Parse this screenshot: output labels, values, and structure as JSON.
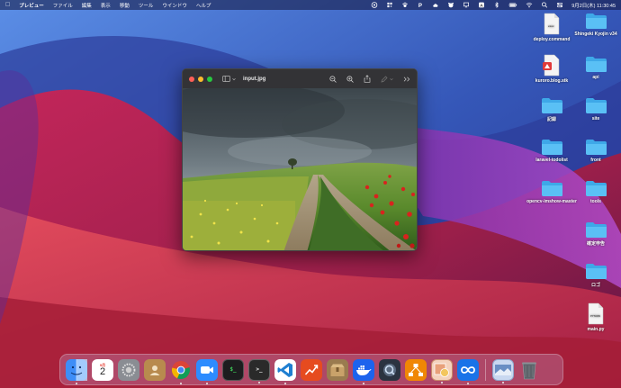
{
  "menubar": {
    "apple_icon": "apple-icon",
    "app_name": "プレビュー",
    "menus": [
      "ファイル",
      "編集",
      "表示",
      "移動",
      "ツール",
      "ウインドウ",
      "ヘルプ"
    ],
    "status_icons": [
      "obs-icon",
      "qr-icon",
      "paw-icon",
      "patreon-icon",
      "cloud-icon",
      "bear-icon",
      "cast-icon",
      "input-method-icon",
      "bluetooth-icon",
      "battery-icon",
      "wifi-icon",
      "search-icon",
      "control-center-icon"
    ],
    "input_method": "A",
    "clock": "9月2日(木)  11:30:45"
  },
  "desktop": {
    "items": [
      {
        "label": "deploy.command",
        "type": "document",
        "doc_label": "exec"
      },
      {
        "label": "Shingeki Kyojin v34",
        "type": "folder"
      },
      {
        "label": "kuroro.blog.stk",
        "type": "document",
        "doc_label": ""
      },
      {
        "label": "api",
        "type": "folder"
      },
      {
        "label": "記録",
        "type": "folder"
      },
      {
        "label": "site",
        "type": "folder"
      },
      {
        "label": "laravel-todolist",
        "type": "folder"
      },
      {
        "label": "front",
        "type": "folder"
      },
      {
        "label": "opencv-imshow-master",
        "type": "folder"
      },
      {
        "label": "tools",
        "type": "folder"
      },
      {
        "label": "確定申告",
        "type": "folder"
      },
      {
        "label": "ロゴ",
        "type": "folder"
      },
      {
        "label": "main.py",
        "type": "document",
        "doc_label": "PYTHON"
      }
    ]
  },
  "window": {
    "title": "input.jpg",
    "toolbar_icons": [
      "sidebar-toggle-icon",
      "zoom-out-icon",
      "zoom-in-icon",
      "share-icon",
      "markup-icon",
      "more-icon"
    ]
  },
  "dock": {
    "apps": [
      {
        "name": "finder",
        "color": "#3d8ef7",
        "running": true
      },
      {
        "name": "calendar",
        "color": "#ffffff",
        "label": "2",
        "month": "9月",
        "running": false
      },
      {
        "name": "system-preferences",
        "color": "#8a8d93",
        "running": false
      },
      {
        "name": "contacts",
        "color": "#b88a4e",
        "running": false
      },
      {
        "name": "chrome",
        "color": "#ffffff",
        "running": true
      },
      {
        "name": "zoom",
        "color": "#2d8cff",
        "running": true
      },
      {
        "name": "activity-terminal",
        "color": "#1d1d1f",
        "label": "$_",
        "running": false
      },
      {
        "name": "terminal",
        "color": "#2a2a2a",
        "label": ">_",
        "running": true
      },
      {
        "name": "vscode",
        "color": "#1f7fd1",
        "running": true
      },
      {
        "name": "app-analytics",
        "color": "#e64b1f",
        "running": false
      },
      {
        "name": "archive-utility",
        "color": "#9a7b4f",
        "running": false
      },
      {
        "name": "docker",
        "color": "#1d63ed",
        "running": true
      },
      {
        "name": "quicktime",
        "color": "#2b3340",
        "running": false
      },
      {
        "name": "draw-io",
        "color": "#f08705",
        "running": false
      },
      {
        "name": "preview",
        "color": "#e8a07a",
        "running": true
      },
      {
        "name": "infinity-app",
        "color": "#1a73e8",
        "running": true
      },
      {
        "name": "screenshot-folder",
        "color": "#c9d8f0",
        "running": true
      },
      {
        "name": "trash",
        "color": "#555a60",
        "running": false
      }
    ]
  }
}
